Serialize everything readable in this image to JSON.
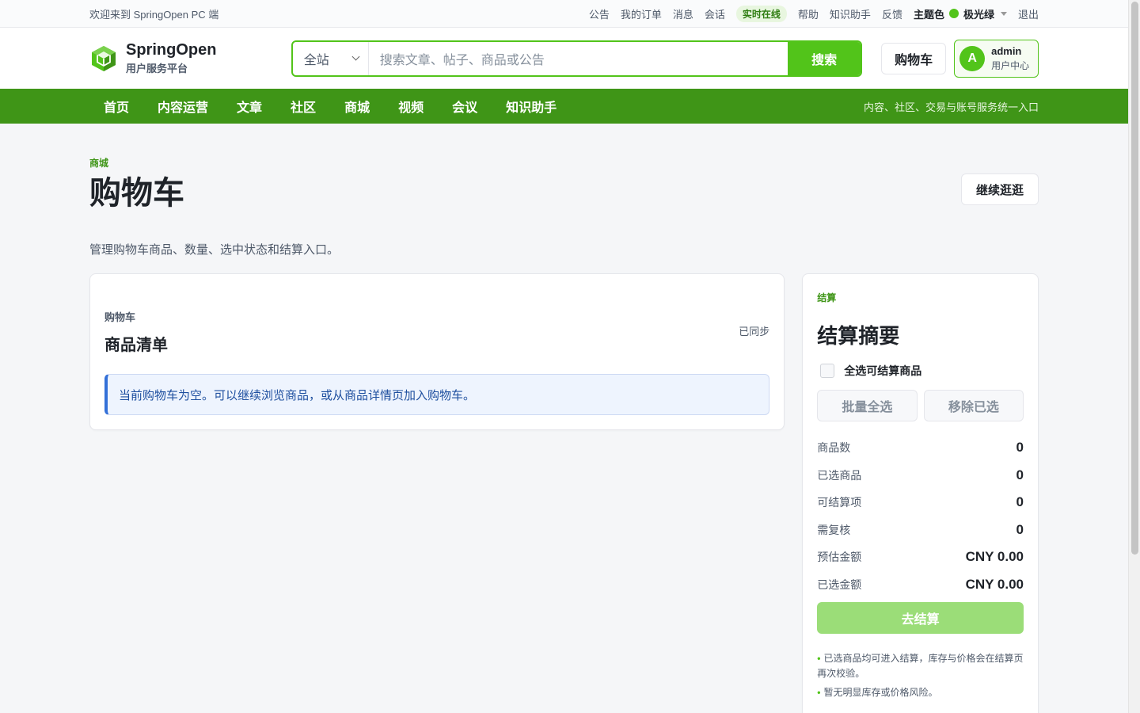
{
  "topbar": {
    "welcome": "欢迎来到 SpringOpen PC 端",
    "links": [
      "公告",
      "我的订单",
      "消息",
      "会话"
    ],
    "online": "实时在线",
    "links2": [
      "帮助",
      "知识助手",
      "反馈"
    ],
    "theme_label": "主题色",
    "theme_value": "极光绿",
    "logout": "退出"
  },
  "header": {
    "brand": "SpringOpen",
    "brand_sub": "用户服务平台",
    "search_scope": "全站",
    "search_placeholder": "搜索文章、帖子、商品或公告",
    "search_button": "搜索",
    "cart_button": "购物车",
    "avatar_letter": "A",
    "username": "admin",
    "user_center": "用户中心"
  },
  "nav": {
    "items": [
      "首页",
      "内容运营",
      "文章",
      "社区",
      "商城",
      "视频",
      "会议",
      "知识助手"
    ],
    "tagline": "内容、社区、交易与账号服务统一入口"
  },
  "page": {
    "breadcrumb": "商城",
    "title": "购物车",
    "continue_button": "继续逛逛",
    "description": "管理购物车商品、数量、选中状态和结算入口。"
  },
  "cart_list": {
    "small_label": "购物车",
    "heading": "商品清单",
    "sync_status": "已同步",
    "empty_message": "当前购物车为空。可以继续浏览商品，或从商品详情页加入购物车。"
  },
  "summary": {
    "tag": "结算",
    "heading": "结算摘要",
    "select_all_label": "全选可结算商品",
    "batch_select": "批量全选",
    "remove_selected": "移除已选",
    "stats": [
      {
        "label": "商品数",
        "value": "0"
      },
      {
        "label": "已选商品",
        "value": "0"
      },
      {
        "label": "可结算项",
        "value": "0"
      },
      {
        "label": "需复核",
        "value": "0"
      },
      {
        "label": "预估金额",
        "value": "CNY 0.00"
      },
      {
        "label": "已选金额",
        "value": "CNY 0.00"
      }
    ],
    "checkout_button": "去结算",
    "notes": [
      "已选商品均可进入结算，库存与价格会在结算页再次校验。",
      "暂无明显库存或价格风险。"
    ]
  },
  "colors": {
    "brand": "#52c41a",
    "nav": "#3f9517",
    "info": "#3370d8"
  }
}
